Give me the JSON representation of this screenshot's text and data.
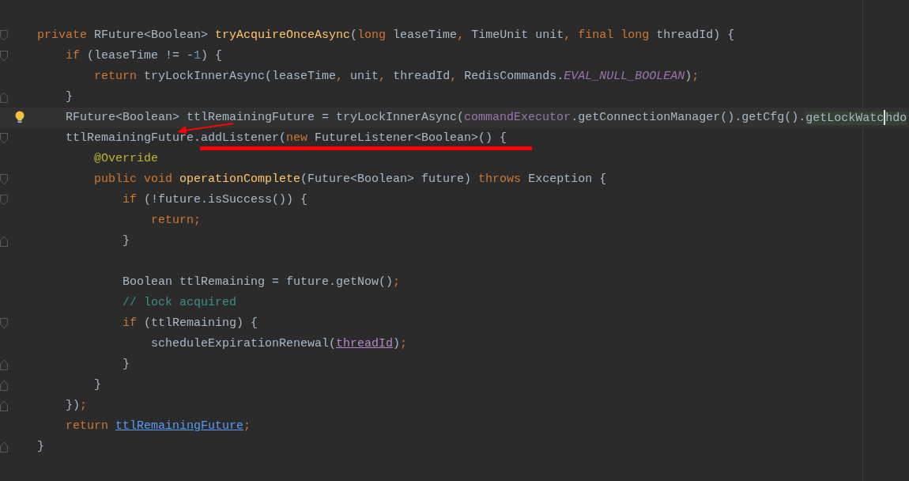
{
  "editor": {
    "lines": [
      {
        "fold_start": true,
        "tokens": [
          {
            "kind": "keyword",
            "text": "private "
          },
          {
            "kind": "plain",
            "text": "RFuture<Boolean> "
          },
          {
            "kind": "declaration",
            "text": "tryAcquireOnceAsync"
          },
          {
            "kind": "plain",
            "text": "("
          },
          {
            "kind": "keyword",
            "text": "long "
          },
          {
            "kind": "plain",
            "text": "leaseTime"
          },
          {
            "kind": "punct",
            "text": ", "
          },
          {
            "kind": "plain",
            "text": "TimeUnit unit"
          },
          {
            "kind": "punct",
            "text": ", "
          },
          {
            "kind": "keyword",
            "text": "final long "
          },
          {
            "kind": "plain",
            "text": "threadId) {"
          }
        ]
      },
      {
        "fold_start": true,
        "tokens": [
          {
            "kind": "keyword",
            "text": "    if "
          },
          {
            "kind": "plain",
            "text": "(leaseTime != -"
          },
          {
            "kind": "number",
            "text": "1"
          },
          {
            "kind": "plain",
            "text": ") {"
          }
        ]
      },
      {
        "tokens": [
          {
            "kind": "keyword",
            "text": "        return "
          },
          {
            "kind": "plain",
            "text": "tryLockInnerAsync(leaseTime"
          },
          {
            "kind": "punct",
            "text": ", "
          },
          {
            "kind": "plain",
            "text": "unit"
          },
          {
            "kind": "punct",
            "text": ", "
          },
          {
            "kind": "plain",
            "text": "threadId"
          },
          {
            "kind": "punct",
            "text": ", "
          },
          {
            "kind": "plain",
            "text": "RedisCommands."
          },
          {
            "kind": "constant",
            "text": "EVAL_NULL_BOOLEAN"
          },
          {
            "kind": "plain",
            "text": ")"
          },
          {
            "kind": "punct",
            "text": ";"
          }
        ]
      },
      {
        "fold_end": true,
        "tokens": [
          {
            "kind": "plain",
            "text": "    }"
          }
        ]
      },
      {
        "current": true,
        "bulb": true,
        "tokens": [
          {
            "kind": "plain",
            "text": "    RFuture<Boolean> ttlRemainingFuture = tryLockInnerAsync("
          },
          {
            "kind": "field",
            "text": "commandExecutor"
          },
          {
            "kind": "plain",
            "text": ".getConnectionManager().getCfg()."
          },
          {
            "kind": "match",
            "text": "getLockWatc"
          },
          {
            "kind": "caret"
          },
          {
            "kind": "match",
            "text": "hdo"
          }
        ]
      },
      {
        "fold_start": true,
        "annotated": true,
        "tokens": [
          {
            "kind": "plain",
            "text": "    ttlRemainingFuture.addListener("
          },
          {
            "kind": "keyword",
            "text": "new "
          },
          {
            "kind": "plain",
            "text": "FutureListener<Boolean>() {"
          }
        ]
      },
      {
        "tokens": [
          {
            "kind": "annotation",
            "text": "        @Override"
          }
        ]
      },
      {
        "fold_start": true,
        "tokens": [
          {
            "kind": "keyword",
            "text": "        public void "
          },
          {
            "kind": "declaration",
            "text": "operationComplete"
          },
          {
            "kind": "plain",
            "text": "(Future<Boolean> future) "
          },
          {
            "kind": "keyword",
            "text": "throws "
          },
          {
            "kind": "plain",
            "text": "Exception {"
          }
        ]
      },
      {
        "fold_start": true,
        "tokens": [
          {
            "kind": "keyword",
            "text": "            if "
          },
          {
            "kind": "plain",
            "text": "(!future.isSuccess()) {"
          }
        ]
      },
      {
        "tokens": [
          {
            "kind": "keyword",
            "text": "                return;"
          }
        ]
      },
      {
        "fold_end": true,
        "tokens": [
          {
            "kind": "plain",
            "text": "            }"
          }
        ]
      },
      {
        "blank": true
      },
      {
        "tokens": [
          {
            "kind": "plain",
            "text": "            Boolean ttlRemaining = future.getNow()"
          },
          {
            "kind": "punct",
            "text": ";"
          }
        ]
      },
      {
        "tokens": [
          {
            "kind": "comment",
            "text": "            // lock acquired"
          }
        ]
      },
      {
        "fold_start": true,
        "tokens": [
          {
            "kind": "keyword",
            "text": "            if "
          },
          {
            "kind": "plain",
            "text": "(ttlRemaining) {"
          }
        ]
      },
      {
        "tokens": [
          {
            "kind": "plain",
            "text": "                scheduleExpirationRenewal("
          },
          {
            "kind": "param-link",
            "text": "threadId"
          },
          {
            "kind": "plain",
            "text": ")"
          },
          {
            "kind": "punct",
            "text": ";"
          }
        ]
      },
      {
        "fold_end": true,
        "tokens": [
          {
            "kind": "plain",
            "text": "            }"
          }
        ]
      },
      {
        "fold_end": true,
        "tokens": [
          {
            "kind": "plain",
            "text": "        }"
          }
        ]
      },
      {
        "fold_end": true,
        "tokens": [
          {
            "kind": "plain",
            "text": "    })"
          },
          {
            "kind": "punct",
            "text": ";"
          }
        ]
      },
      {
        "tokens": [
          {
            "kind": "keyword",
            "text": "    return "
          },
          {
            "kind": "var-link",
            "text": "ttlRemainingFuture"
          },
          {
            "kind": "punct",
            "text": ";"
          }
        ]
      },
      {
        "fold_end": true,
        "tokens": [
          {
            "kind": "plain",
            "text": "}"
          }
        ]
      }
    ]
  }
}
